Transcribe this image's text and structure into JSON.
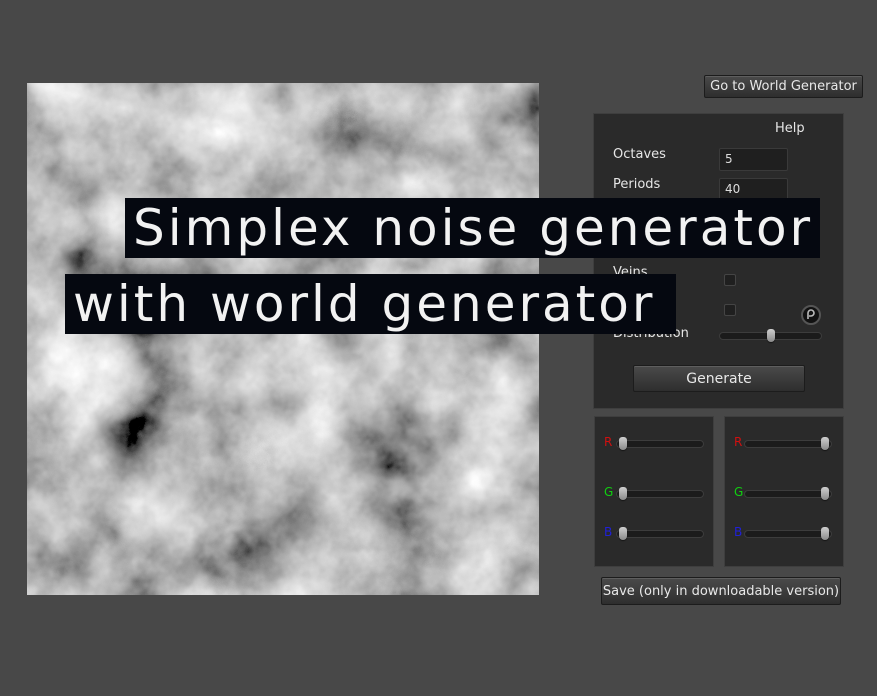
{
  "header": {
    "world_generator_button": "Go to World Generator"
  },
  "settings": {
    "help_label": "Help",
    "octaves": {
      "label": "Octaves",
      "value": "5"
    },
    "periods": {
      "label": "Periods",
      "value": "40"
    },
    "veins": {
      "label": "Veins",
      "checked": false
    },
    "hidden_checkbox": {
      "checked": false
    },
    "distribution": {
      "label": "Distribution",
      "slider_value": 0.5
    },
    "generate_button": "Generate"
  },
  "color_low": {
    "r": {
      "label": "R",
      "value": 0.0
    },
    "g": {
      "label": "G",
      "value": 0.0
    },
    "b": {
      "label": "B",
      "value": 0.0
    }
  },
  "color_high": {
    "r": {
      "label": "R",
      "value": 1.0
    },
    "g": {
      "label": "G",
      "value": 1.0
    },
    "b": {
      "label": "B",
      "value": 1.0
    }
  },
  "save_button": "Save (only in downloadable version)",
  "overlay": {
    "line1": "Simplex noise generator",
    "line2": "with world generator"
  },
  "colors": {
    "background": "#484848",
    "panel": "#2a2a2a",
    "red_label": "#d01010",
    "green_label": "#10d010",
    "blue_label": "#2020d8"
  }
}
